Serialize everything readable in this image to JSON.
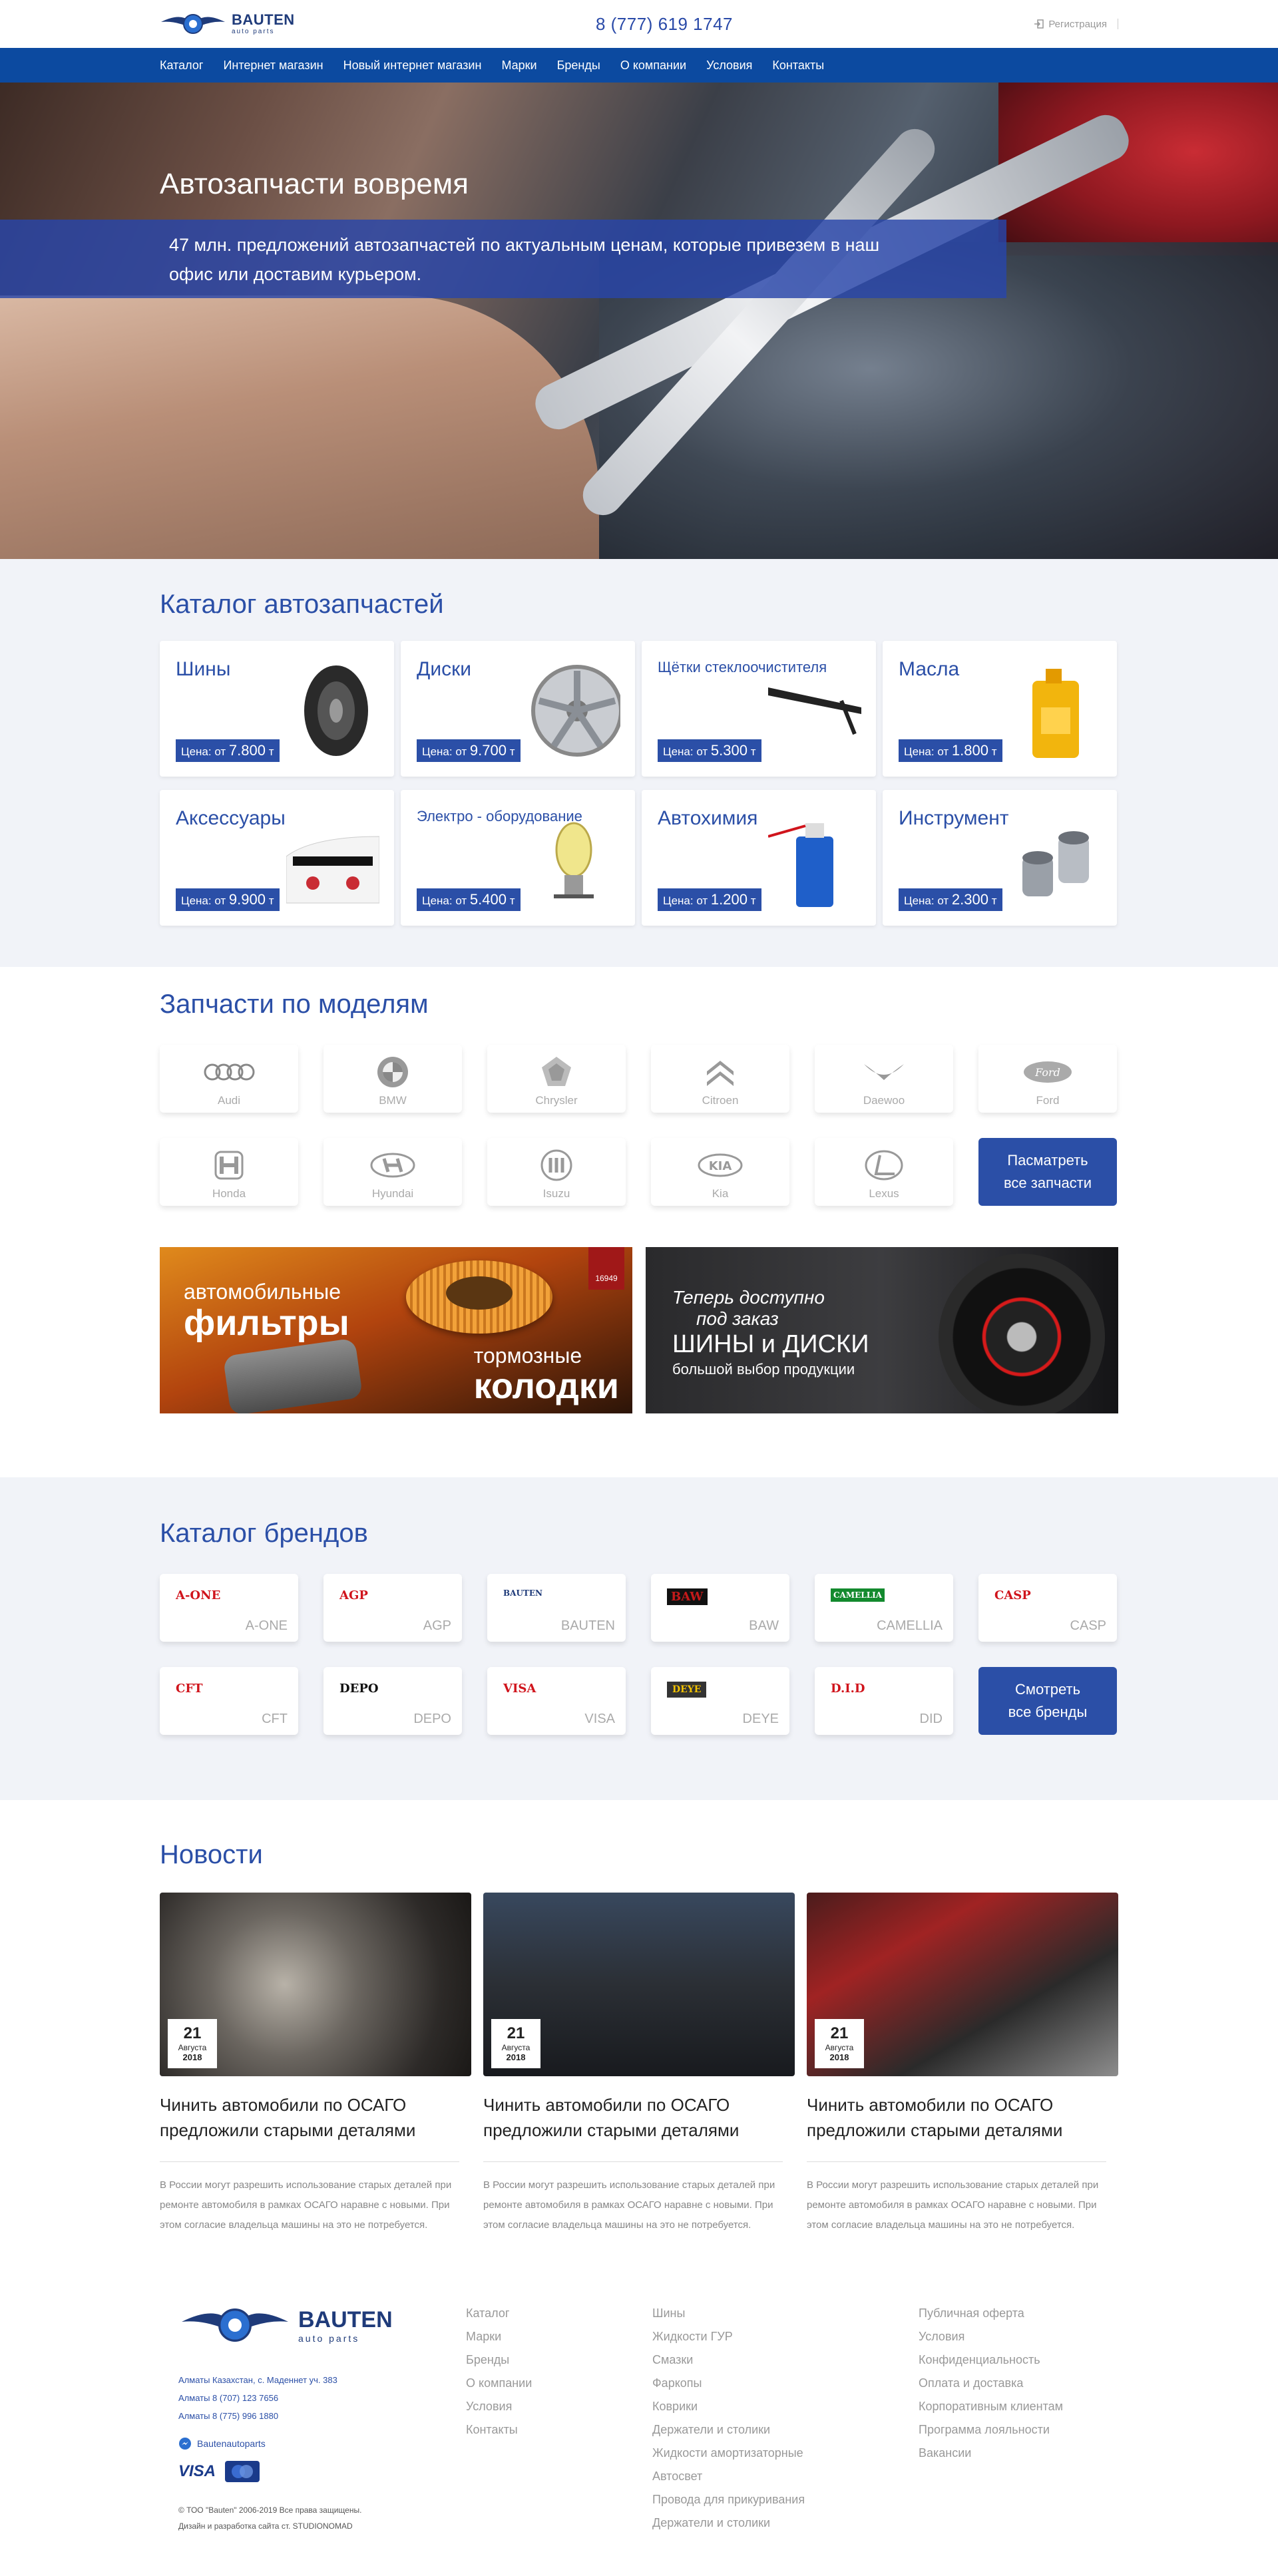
{
  "header": {
    "logo_brand": "BAUTEN",
    "logo_sub": "auto parts",
    "phone": "8 (777) 619 1747",
    "register": "Регистрация"
  },
  "nav": [
    "Каталог",
    "Интернет магазин",
    "Новый интернет магазин",
    "Марки",
    "Бренды",
    "О компании",
    "Условия",
    "Контакты"
  ],
  "hero": {
    "title": "Автозапчасти вовремя",
    "text": "47 млн. предложений автозапчастей по актуальным ценам, которые привезем в наш офис или доставим курьером."
  },
  "catalog": {
    "title": "Каталог автозапчастей",
    "price_prefix": "Цена: от",
    "currency": "т",
    "items": [
      {
        "name": "Шины",
        "price": "7.800",
        "icon": "tire-image"
      },
      {
        "name": "Диски",
        "price": "9.700",
        "icon": "wheel-rim-image"
      },
      {
        "name": "Щётки стеклоочистителя",
        "price": "5.300",
        "icon": "wiper-blade-image"
      },
      {
        "name": "Масла",
        "price": "1.800",
        "icon": "oil-canister-image"
      },
      {
        "name": "Аксессуары",
        "price": "9.900",
        "icon": "car-accessory-image"
      },
      {
        "name": "Электро - оборудование",
        "price": "5.400",
        "icon": "headlight-bulb-image"
      },
      {
        "name": "Автохимия",
        "price": "1.200",
        "icon": "chemical-can-image"
      },
      {
        "name": "Инструмент",
        "price": "2.300",
        "icon": "socket-tools-image"
      }
    ]
  },
  "models": {
    "title": "Запчасти по моделям",
    "items": [
      "Audi",
      "BMW",
      "Chrysler",
      "Citroen",
      "Daewoo",
      "Ford",
      "Honda",
      "Hyundai",
      "Isuzu",
      "Kia",
      "Lexus"
    ],
    "all_button": "Пасматреть все запчасти"
  },
  "banners": {
    "b1_line1": "автомобильные",
    "b1_big1": "фильтры",
    "b1_line2": "тормозные",
    "b1_big2": "колодки",
    "b1_badge": "16949",
    "b2_line1": "Теперь доступно",
    "b2_line2": "под заказ",
    "b2_big": "ШИНЫ и ДИСКИ",
    "b2_small": "большой выбор продукции"
  },
  "brands": {
    "title": "Каталог брендов",
    "items": [
      {
        "logo": "A-ONE",
        "name": "A-ONE",
        "color": "#d0141c"
      },
      {
        "logo": "AGP",
        "name": "AGP",
        "color": "#d0141c"
      },
      {
        "logo": "BAUTEN",
        "name": "BAUTEN",
        "color": "#1f3b7a"
      },
      {
        "logo": "BAW",
        "name": "BAW",
        "color": "#c41a1a"
      },
      {
        "logo": "CAMELLIA",
        "name": "CAMELLIA",
        "color": "#138a2e"
      },
      {
        "logo": "CASP",
        "name": "CASP",
        "color": "#d0141c"
      },
      {
        "logo": "CFT",
        "name": "CFT",
        "color": "#d0141c"
      },
      {
        "logo": "DEPO",
        "name": "DEPO",
        "color": "#111111"
      },
      {
        "logo": "VISA",
        "name": "VISA",
        "color": "#d0141c"
      },
      {
        "logo": "DEYE",
        "name": "DEYE",
        "color": "#444444"
      },
      {
        "logo": "D.I.D",
        "name": "DID",
        "color": "#d0141c"
      }
    ],
    "all_button": "Смотреть все бренды"
  },
  "news": {
    "title": "Новости",
    "items": [
      {
        "day": "21",
        "month": "Августа",
        "year": "2018",
        "title": "Чинить автомобили по ОСАГО предложили старыми деталями",
        "text": "В России могут разрешить использование старых деталей при ремонте автомобиля в рамках ОСАГО наравне с новыми. При этом согласие владельца машины на это не потребуется."
      },
      {
        "day": "21",
        "month": "Августа",
        "year": "2018",
        "title": "Чинить автомобили по ОСАГО предложили старыми деталями",
        "text": "В России могут разрешить использование старых деталей при ремонте автомобиля в рамках ОСАГО наравне с новыми. При этом согласие владельца машины на это не потребуется."
      },
      {
        "day": "21",
        "month": "Августа",
        "year": "2018",
        "title": "Чинить автомобили по ОСАГО предложили старыми деталями",
        "text": "В России могут разрешить использование старых деталей при ремонте автомобиля в рамках ОСАГО наравне с новыми. При этом согласие владельца машины на это не потребуется."
      }
    ]
  },
  "footer": {
    "logo_brand": "BAUTEN",
    "logo_sub": "auto parts",
    "address": "Алматы Казахстан, с. Маденнет уч. 383",
    "phone1": "Алматы  8 (707) 123 7656",
    "phone2": "Алматы 8 (775) 996 1880",
    "messenger": "Bautenautoparts",
    "pay_visa": "VISA",
    "pay_mc": "MasterCard",
    "copyright": "© ТОО \"Bauten\" 2006-2019 Все права защищены.",
    "dev": "Дизайн и разработка сайта ст. STUDIONOMAD",
    "col1": [
      "Каталог",
      "Марки",
      "Бренды",
      "О компании",
      "Условия",
      "Контакты"
    ],
    "col2": [
      "Шины",
      "Жидкости ГУР",
      "Смазки",
      "Фаркопы",
      "Коврики",
      "Держатели и столики",
      "Жидкости амортизаторные",
      "Автосвет",
      "Провода для прикуривания",
      "Держатели и столики"
    ],
    "col3": [
      "Публичная оферта",
      "Условия",
      "Конфиденциальность",
      "Оплата и доставка",
      "Корпоративным клиентам",
      "Программа лояльности",
      "Вакансии"
    ]
  }
}
